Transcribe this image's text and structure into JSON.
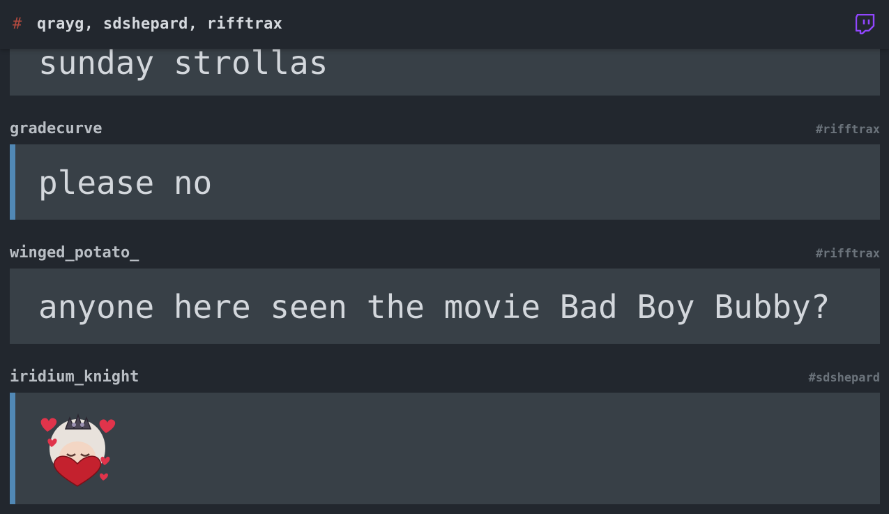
{
  "header": {
    "hash": "#",
    "channels": "qrayg, sdshepard, rifftrax",
    "twitch_icon": "twitch-icon"
  },
  "messages": [
    {
      "user": "",
      "channel": "",
      "text": "sunday strollas",
      "highlight": false
    },
    {
      "user": "gradecurve",
      "channel": "#rifftrax",
      "text": "please no",
      "highlight": true
    },
    {
      "user": "winged_potato_",
      "channel": "#rifftrax",
      "text": "anyone here seen the movie Bad Boy Bubby?",
      "highlight": false
    },
    {
      "user": "iridium_knight",
      "channel": "#sdshepard",
      "emote": "heart-emote",
      "highlight": true
    }
  ],
  "colors": {
    "background": "#22272e",
    "message_bg": "#384047",
    "highlight_bar": "#5188b5",
    "hash": "#b24a3f",
    "twitch": "#9146ff"
  }
}
